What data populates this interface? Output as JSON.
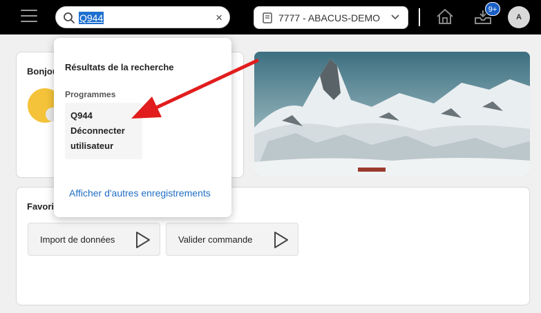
{
  "search": {
    "value": "Q944",
    "selected_text": "Q944",
    "clear_glyph": "×"
  },
  "company": {
    "label": "7777 - ABACUS-DEMO"
  },
  "header": {
    "notification_badge": "9+",
    "avatar_initial": "A"
  },
  "greeting_card": {
    "title": "Bonjou"
  },
  "favorites": {
    "title": "Favori",
    "tiles": [
      {
        "label": "Import de données"
      },
      {
        "label": "Valider commande"
      }
    ]
  },
  "search_results": {
    "heading": "Résultats de la recherche",
    "section": "Programmes",
    "result": {
      "line1": "Q944",
      "line2": "Déconnecter",
      "line3": "utilisateur"
    },
    "more_link": "Afficher d'autres enregistrements"
  },
  "colors": {
    "accent": "#1f6ec4",
    "badge": "#1a5fc7",
    "arrow": "#e11d1d",
    "topbar": "#000000"
  },
  "icons": [
    "menu-icon",
    "search-icon",
    "close-icon",
    "book-icon",
    "chevron-down-icon",
    "home-icon",
    "inbox-download-icon",
    "play-icon"
  ]
}
